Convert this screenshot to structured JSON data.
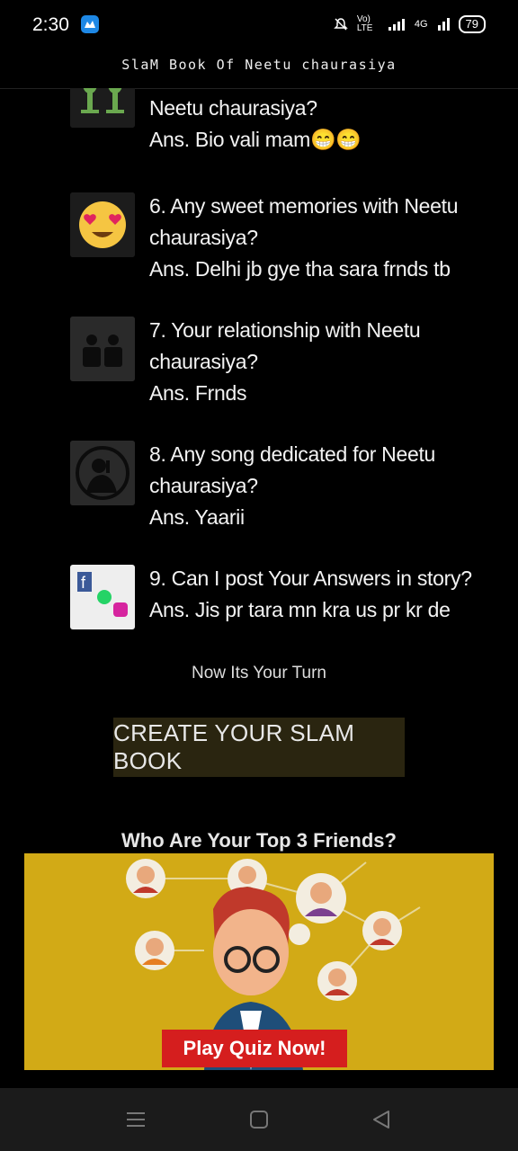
{
  "status": {
    "time": "2:30",
    "net1": "Vo) LTE",
    "net2": "4G",
    "battery": "79"
  },
  "header": {
    "title": "SlaM Book Of Neetu chaurasiya"
  },
  "qa": [
    {
      "lines": [
        "Neetu chaurasiya?",
        "Ans. Bio vali mam😁😁"
      ]
    },
    {
      "lines": [
        "6. Any sweet memories with Neetu",
        "chaurasiya?",
        "Ans. Delhi jb gye tha sara frnds tb"
      ]
    },
    {
      "lines": [
        "7. Your relationship with Neetu",
        "chaurasiya?",
        "Ans. Frnds"
      ]
    },
    {
      "lines": [
        "8. Any song dedicated for Neetu",
        "chaurasiya?",
        "Ans. Yaarii"
      ]
    },
    {
      "lines": [
        "9. Can I post Your Answers in story?",
        "Ans. Jis pr tara mn kra us pr kr de"
      ]
    }
  ],
  "turn_text": "Now Its Your Turn",
  "create_button": "CREATE YOUR SLAM BOOK",
  "ad": {
    "title": "Who Are Your Top 3 Friends?",
    "button": "Play Quiz Now!"
  },
  "icons": {
    "qa": [
      "alien-pair-icon",
      "heart-eyes-emoji-icon",
      "friends-icon",
      "singer-icon",
      "social-media-icon"
    ],
    "nav": [
      "menu-icon",
      "home-icon",
      "back-icon"
    ]
  }
}
